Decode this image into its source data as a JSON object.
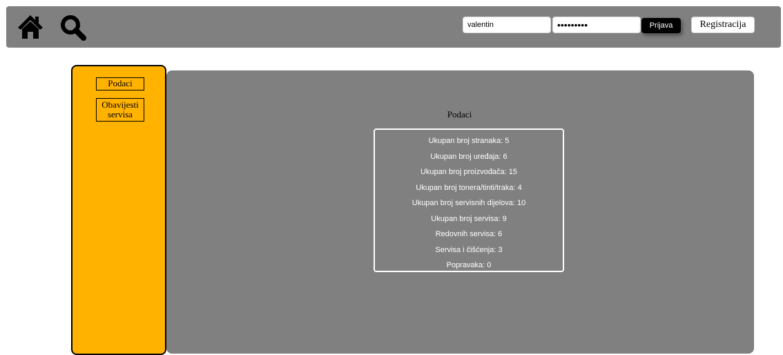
{
  "header": {
    "username_value": "valentin",
    "password_value": "•••••••••",
    "login_label": "Prijava",
    "register_label": "Registracija"
  },
  "sidebar": {
    "items": [
      {
        "label": "Podaci"
      },
      {
        "label": "Obavijesti servisa"
      }
    ]
  },
  "main": {
    "title": "Podaci",
    "stats": [
      "Ukupan broj stranaka: 5",
      "Ukupan broj uređaja: 6",
      "Ukupan broj proizvođača: 15",
      "Ukupan broj tonera/tinti/traka: 4",
      "Ukupan broj servisnih dijelova: 10",
      "Ukupan broj servisa: 9",
      "Redovnih servisa: 6",
      "Servisa i čišćenja: 3",
      "Popravaka: 0"
    ]
  },
  "colors": {
    "topbar": "#808080",
    "sidebar": "#ffb300",
    "panel": "#808080"
  },
  "icons": [
    "home-icon",
    "search-icon"
  ]
}
